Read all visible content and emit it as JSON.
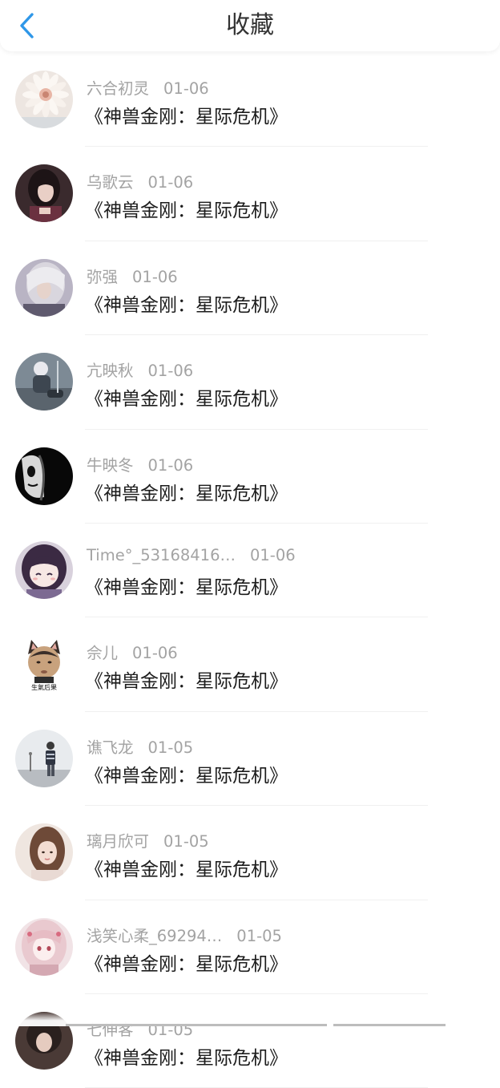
{
  "header": {
    "title": "收藏",
    "back_icon": "chevron-left-icon",
    "accent_color": "#2f97e8"
  },
  "items": [
    {
      "name": "六合初灵",
      "date": "01-06",
      "title": "《神兽金刚：星际危机》",
      "avatar": "flower-avatar"
    },
    {
      "name": "乌歌云",
      "date": "01-06",
      "title": "《神兽金刚：星际危机》",
      "avatar": "dark-hair-girl-avatar"
    },
    {
      "name": "弥强",
      "date": "01-06",
      "title": "《神兽金刚：星际危机》",
      "avatar": "silver-hair-avatar"
    },
    {
      "name": "亢映秋",
      "date": "01-06",
      "title": "《神兽金刚：星际危机》",
      "avatar": "skater-avatar"
    },
    {
      "name": "牛映冬",
      "date": "01-06",
      "title": "《神兽金刚：星际危机》",
      "avatar": "mask-avatar"
    },
    {
      "name": "Time°_53168416…",
      "date": "01-06",
      "title": "《神兽金刚：星际危机》",
      "avatar": "anime-girl-avatar"
    },
    {
      "name": "佘儿",
      "date": "01-06",
      "title": "《神兽金刚：星际危机》",
      "avatar": "cat-ears-baby-avatar"
    },
    {
      "name": "谯飞龙",
      "date": "01-05",
      "title": "《神兽金刚：星际危机》",
      "avatar": "street-photo-avatar"
    },
    {
      "name": "璃月欣可",
      "date": "01-05",
      "title": "《神兽金刚：星际危机》",
      "avatar": "girl-portrait-avatar"
    },
    {
      "name": "浅笑心柔_69294…",
      "date": "01-05",
      "title": "《神兽金刚：星际危机》",
      "avatar": "pink-anime-avatar"
    },
    {
      "name": "七伸客",
      "date": "01-05",
      "title": "《神兽金刚：星际危机》",
      "avatar": "partial-avatar"
    }
  ],
  "avatar_badge_text": "生氣后果",
  "colors": {
    "name_text": "#a3a3a3",
    "content_text": "#1c1c1c",
    "divider": "#f0f0f0"
  }
}
